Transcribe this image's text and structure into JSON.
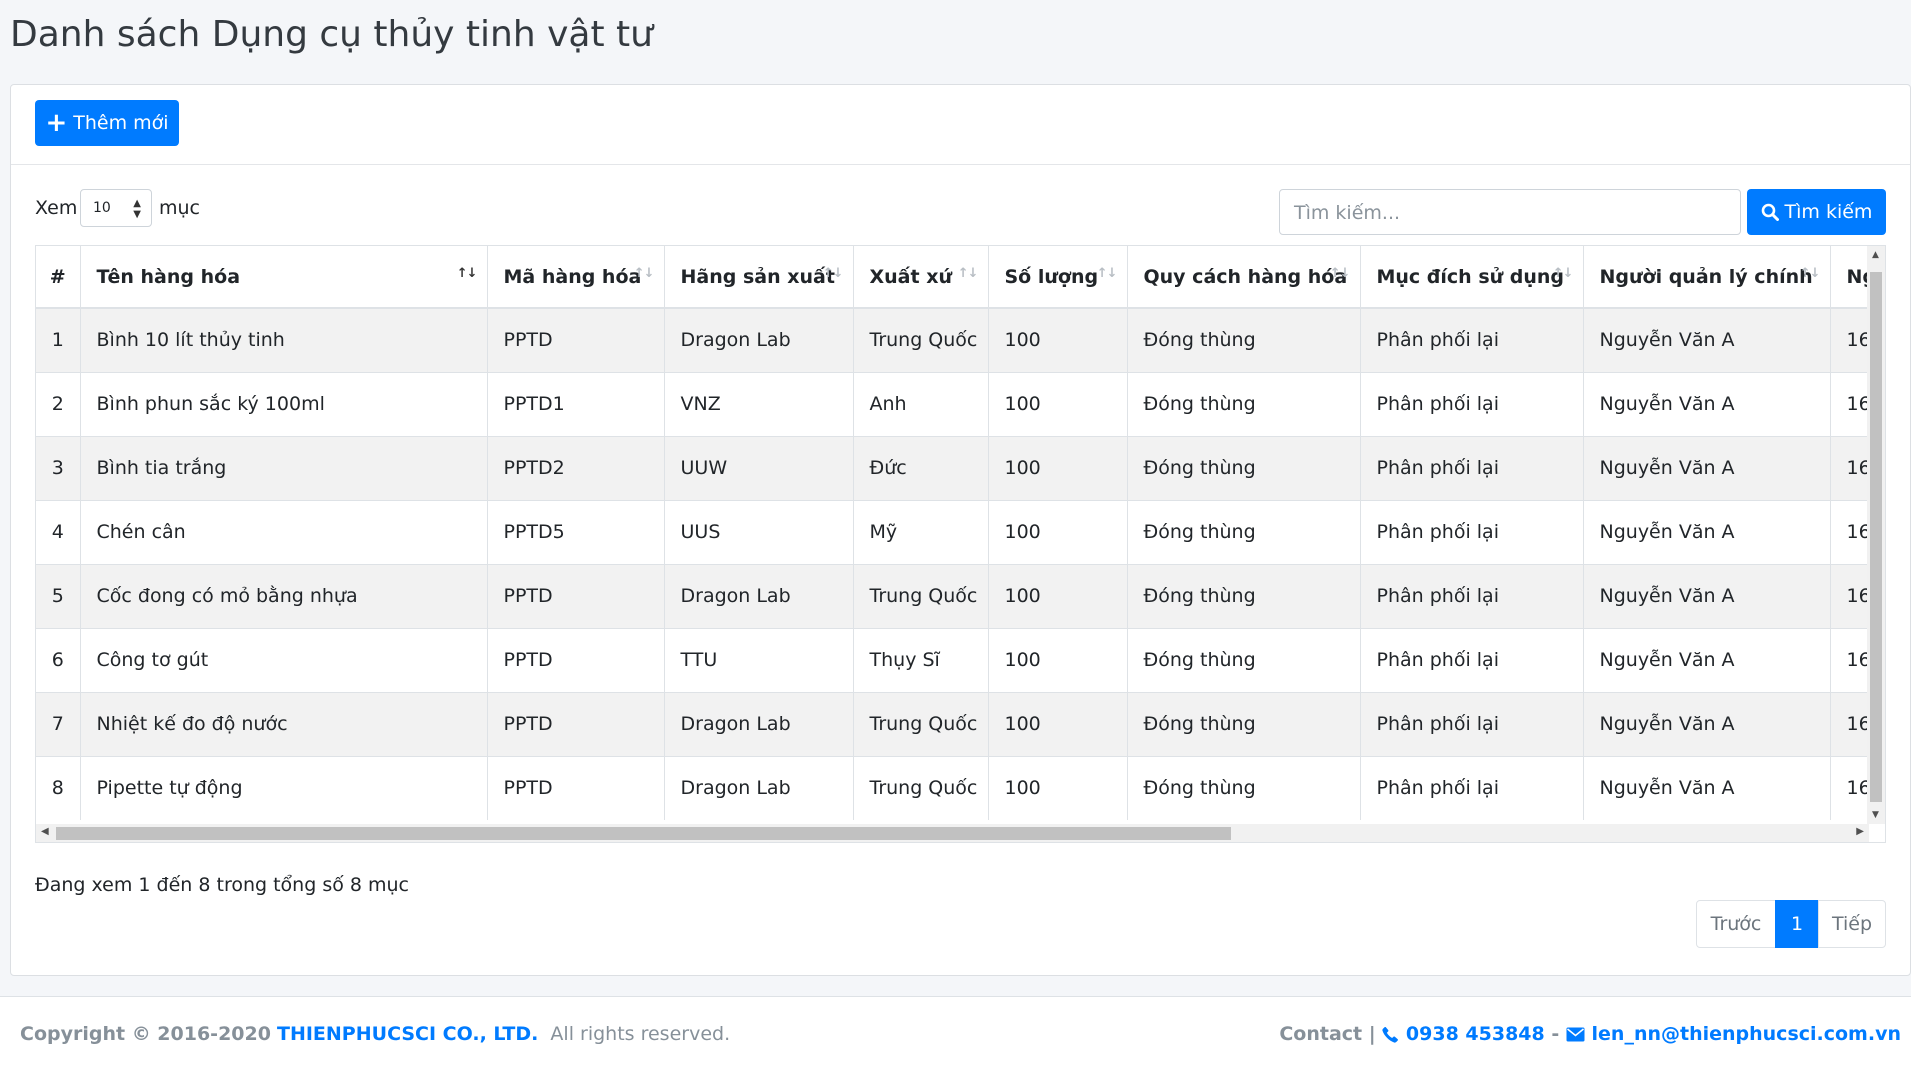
{
  "page": {
    "title": "Danh sách Dụng cụ thủy tinh vật tư"
  },
  "toolbar": {
    "add_label": "Thêm mới"
  },
  "length_menu": {
    "label_before": "Xem",
    "value": "10",
    "label_after": "mục"
  },
  "search": {
    "placeholder": "Tìm kiếm...",
    "button_label": "Tìm kiếm"
  },
  "table": {
    "columns": [
      "#",
      "Tên hàng hóa",
      "Mã hàng hóa",
      "Hãng sản xuất",
      "Xuất xứ",
      "Số lượng",
      "Quy cách hàng hóa",
      "Mục đích sử dụng",
      "Người quản lý chính",
      "Ng"
    ],
    "rows": [
      [
        "1",
        "Bình 10 lít thủy tinh",
        "PPTD",
        "Dragon Lab",
        "Trung Quốc",
        "100",
        "Đóng thùng",
        "Phân phối lại",
        "Nguyễn Văn A",
        "16"
      ],
      [
        "2",
        "Bình phun sắc ký 100ml",
        "PPTD1",
        "VNZ",
        "Anh",
        "100",
        "Đóng thùng",
        "Phân phối lại",
        "Nguyễn Văn A",
        "16"
      ],
      [
        "3",
        "Bình tia trắng",
        "PPTD2",
        "UUW",
        "Đức",
        "100",
        "Đóng thùng",
        "Phân phối lại",
        "Nguyễn Văn A",
        "16"
      ],
      [
        "4",
        "Chén cân",
        "PPTD5",
        "UUS",
        "Mỹ",
        "100",
        "Đóng thùng",
        "Phân phối lại",
        "Nguyễn Văn A",
        "16"
      ],
      [
        "5",
        "Cốc đong có mỏ bằng nhựa",
        "PPTD",
        "Dragon Lab",
        "Trung Quốc",
        "100",
        "Đóng thùng",
        "Phân phối lại",
        "Nguyễn Văn A",
        "16"
      ],
      [
        "6",
        "Công tơ gút",
        "PPTD",
        "TTU",
        "Thụy Sĩ",
        "100",
        "Đóng thùng",
        "Phân phối lại",
        "Nguyễn Văn A",
        "16"
      ],
      [
        "7",
        "Nhiệt kế đo độ nước",
        "PPTD",
        "Dragon Lab",
        "Trung Quốc",
        "100",
        "Đóng thùng",
        "Phân phối lại",
        "Nguyễn Văn A",
        "16"
      ],
      [
        "8",
        "Pipette tự động",
        "PPTD",
        "Dragon Lab",
        "Trung Quốc",
        "100",
        "Đóng thùng",
        "Phân phối lại",
        "Nguyễn Văn A",
        "16"
      ]
    ]
  },
  "info": {
    "text": "Đang xem 1 đến 8 trong tổng số 8 mục"
  },
  "pagination": {
    "prev": "Trước",
    "current": "1",
    "next": "Tiếp"
  },
  "footer": {
    "copyright_prefix": "Copyright © 2016-2020",
    "brand": "THIENPHUCSCI CO., LTD.",
    "rights": "All rights reserved.",
    "contact_label": "Contact |",
    "phone": "0938 453848",
    "separator": "-",
    "email": "len_nn@thienphucsci.com.vn"
  },
  "colors": {
    "primary": "#007bff",
    "stripe": "#f2f2f2",
    "background": "#f4f6f9"
  }
}
